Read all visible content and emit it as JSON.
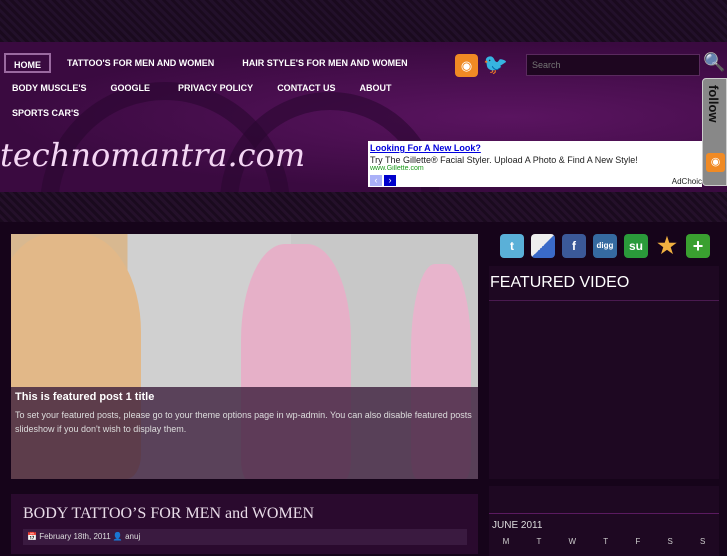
{
  "nav": [
    "HOME",
    "TATTOO'S FOR MEN AND WOMEN",
    "HAIR STYLE'S FOR MEN AND WOMEN",
    "BODY MUSCLE'S",
    "GOOGLE",
    "PRIVACY POLICY",
    "CONTACT US",
    "ABOUT",
    "SPORTS CAR'S"
  ],
  "site_title": "technomantra.com",
  "search": {
    "placeholder": "Search"
  },
  "ad": {
    "title": "Looking For A New Look?",
    "desc": "Try The Gillette® Facial Styler. Upload A Photo & Find A New Style!",
    "url": "www.Gillette.com",
    "choices": "AdChoic"
  },
  "follow": "follow",
  "featured": {
    "title": "This is featured post 1 title",
    "text": "To set your featured posts, please go to your theme options page in wp-admin. You can also disable featured posts slideshow if you don't wish to display them."
  },
  "post": {
    "title": "BODY TATTOO’S FOR MEN and WOMEN",
    "date": "February 18th, 2011",
    "author": "anuj"
  },
  "sidebar": {
    "video_title": "FEATURED VIDEO",
    "calendar_month": "JUNE 2011",
    "days": [
      "M",
      "T",
      "W",
      "T",
      "F",
      "S",
      "S"
    ]
  },
  "social": [
    "twitter",
    "delicious",
    "facebook",
    "digg",
    "stumbleupon",
    "favorite",
    "add"
  ]
}
